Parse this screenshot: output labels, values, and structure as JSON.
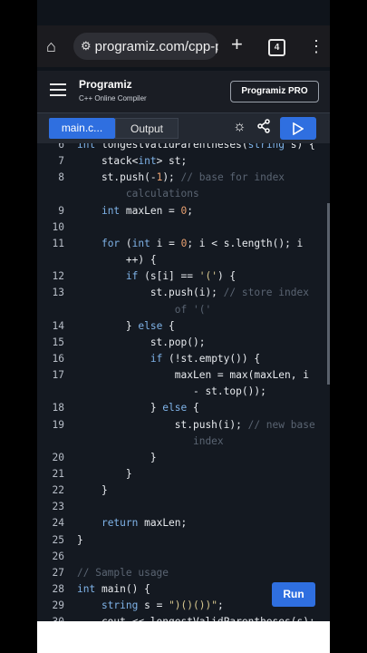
{
  "browser": {
    "url": "programiz.com/cpp-p",
    "tab_count": "4"
  },
  "site": {
    "logo": "Programiz",
    "subtitle": "C++ Online Compiler",
    "pro_button": "Programiz PRO"
  },
  "tabs": {
    "main": "main.c...",
    "output": "Output"
  },
  "editor": {
    "run_label": "Run",
    "lines": [
      {
        "n": "6",
        "code": "int longestValidParentheses(string s) {"
      },
      {
        "n": "7",
        "code": "    stack<int> st;"
      },
      {
        "n": "8",
        "code": "    st.push(-1); // base for index"
      },
      {
        "n": "",
        "code": "        calculations"
      },
      {
        "n": "9",
        "code": "    int maxLen = 0;"
      },
      {
        "n": "10",
        "code": ""
      },
      {
        "n": "11",
        "code": "    for (int i = 0; i < s.length(); i"
      },
      {
        "n": "",
        "code": "        ++) {"
      },
      {
        "n": "12",
        "code": "        if (s[i] == '(') {"
      },
      {
        "n": "13",
        "code": "            st.push(i); // store index"
      },
      {
        "n": "",
        "code": "                of '('"
      },
      {
        "n": "14",
        "code": "        } else {"
      },
      {
        "n": "15",
        "code": "            st.pop();"
      },
      {
        "n": "16",
        "code": "            if (!st.empty()) {"
      },
      {
        "n": "17",
        "code": "                maxLen = max(maxLen, i"
      },
      {
        "n": "",
        "code": "                   - st.top());"
      },
      {
        "n": "18",
        "code": "            } else {"
      },
      {
        "n": "19",
        "code": "                st.push(i); // new base"
      },
      {
        "n": "",
        "code": "                   index"
      },
      {
        "n": "20",
        "code": "            }"
      },
      {
        "n": "21",
        "code": "        }"
      },
      {
        "n": "22",
        "code": "    }"
      },
      {
        "n": "23",
        "code": ""
      },
      {
        "n": "24",
        "code": "    return maxLen;"
      },
      {
        "n": "25",
        "code": "}"
      },
      {
        "n": "26",
        "code": ""
      },
      {
        "n": "27",
        "code": "// Sample usage"
      },
      {
        "n": "28",
        "code": "int main() {"
      },
      {
        "n": "29",
        "code": "    string s = \")()())\";"
      },
      {
        "n": "30",
        "code": "    cout << longestValidParentheses(s);"
      }
    ]
  },
  "colors": {
    "accent": "#2f6fe0",
    "editor_bg": "#141921",
    "keyword": "#7fb3e8",
    "number": "#e8a070",
    "comment": "#5a6472"
  }
}
